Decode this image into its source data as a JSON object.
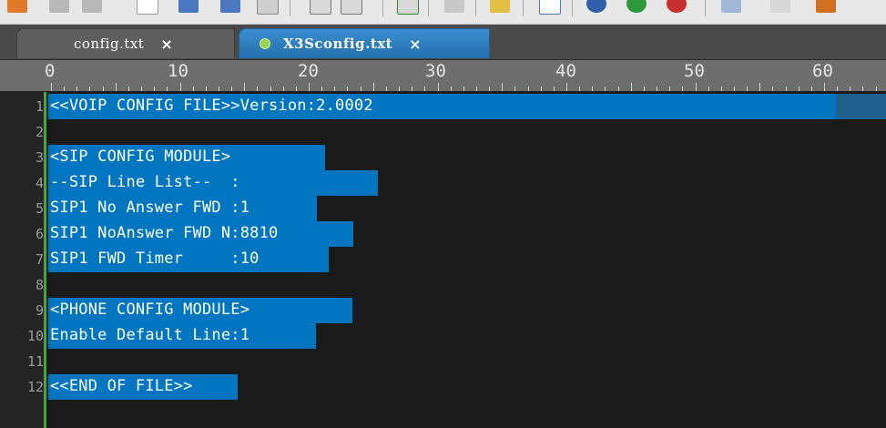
{
  "tabs": [
    {
      "label": "config.txt",
      "close": "×",
      "active": false
    },
    {
      "label": "X3Sconfig.txt",
      "close": "×",
      "active": true
    }
  ],
  "ruler": {
    "labels": [
      "0",
      "10",
      "20",
      "30",
      "40",
      "50",
      "60"
    ]
  },
  "editor": {
    "lines": [
      {
        "num": "1",
        "text": "<<VOIP CONFIG FILE>>Version:2.0002"
      },
      {
        "num": "2",
        "text": ""
      },
      {
        "num": "3",
        "text": "<SIP CONFIG MODULE>"
      },
      {
        "num": "4",
        "text": "--SIP Line List--  :"
      },
      {
        "num": "5",
        "text": "SIP1 No Answer FWD :1"
      },
      {
        "num": "6",
        "text": "SIP1 NoAnswer FWD N:8810"
      },
      {
        "num": "7",
        "text": "SIP1 FWD Timer     :10"
      },
      {
        "num": "8",
        "text": ""
      },
      {
        "num": "9",
        "text": "<PHONE CONFIG MODULE>"
      },
      {
        "num": "10",
        "text": "Enable Default Line:1"
      },
      {
        "num": "11",
        "text": ""
      },
      {
        "num": "12",
        "text": "<<END OF FILE>>"
      }
    ]
  },
  "colors": {
    "selection": "#0076c0",
    "tab_active": "#2f80c4",
    "modified_dot": "#9bd34a"
  }
}
